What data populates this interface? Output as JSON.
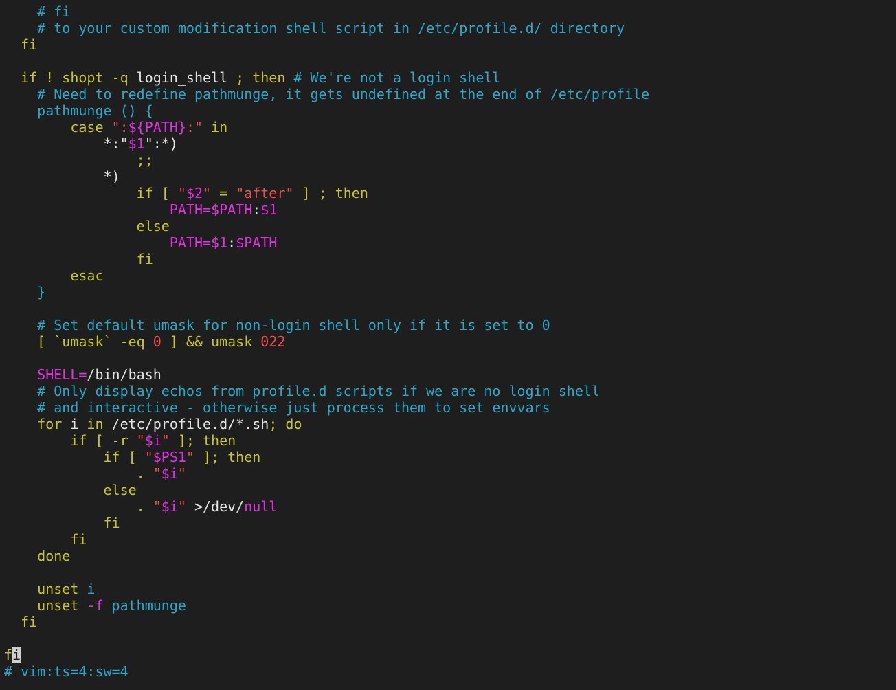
{
  "editor": {
    "name": "vim",
    "theme": {
      "background": "#1e1e1e",
      "comment": "#2aa7c9",
      "keyword": "#c7c62f",
      "plain": "#e4e4e4",
      "special": "#e033e0",
      "number": "#ef4f4f",
      "string": "#ef4f4f",
      "func": "#2aa7c9",
      "cursor": "#cfcfcf"
    },
    "cursor": {
      "line": 39,
      "col": 1
    },
    "lines": [
      [
        [
          "comment",
          "    # fi"
        ]
      ],
      [
        [
          "comment",
          "    # to your custom modification shell script in /etc/profile.d/ directory"
        ]
      ],
      [
        [
          "keyword",
          "  fi"
        ]
      ],
      [],
      [
        [
          "keyword",
          "  if ! shopt -q "
        ],
        [
          "plain",
          "login_shell"
        ],
        [
          "keyword",
          " ; then "
        ],
        [
          "comment",
          "# We're not a login shell"
        ]
      ],
      [
        [
          "comment",
          "    # Need to redefine pathmunge, it gets undefined at the end of /etc/profile"
        ]
      ],
      [
        [
          "func",
          "    pathmunge () {"
        ]
      ],
      [
        [
          "keyword",
          "        case "
        ],
        [
          "string",
          "\":"
        ],
        [
          "special",
          "${PATH}"
        ],
        [
          "string",
          ":\""
        ],
        [
          "keyword",
          " in"
        ]
      ],
      [
        [
          "plain",
          "            *:\""
        ],
        [
          "special",
          "$1"
        ],
        [
          "plain",
          "\":*)"
        ]
      ],
      [
        [
          "keyword",
          "                ;;"
        ]
      ],
      [
        [
          "plain",
          "            *)"
        ]
      ],
      [
        [
          "keyword",
          "                if [ "
        ],
        [
          "string",
          "\""
        ],
        [
          "special",
          "$2"
        ],
        [
          "string",
          "\""
        ],
        [
          "keyword",
          " = "
        ],
        [
          "string",
          "\"after\""
        ],
        [
          "keyword",
          " ] ; then"
        ]
      ],
      [
        [
          "special",
          "                    PATH=$PATH"
        ],
        [
          "plain",
          ":"
        ],
        [
          "special",
          "$1"
        ]
      ],
      [
        [
          "keyword",
          "                else"
        ]
      ],
      [
        [
          "special",
          "                    PATH=$1"
        ],
        [
          "plain",
          ":"
        ],
        [
          "special",
          "$PATH"
        ]
      ],
      [
        [
          "keyword",
          "                fi"
        ]
      ],
      [
        [
          "keyword",
          "        esac"
        ]
      ],
      [
        [
          "func",
          "    }"
        ]
      ],
      [],
      [
        [
          "comment",
          "    # Set default umask for non-login shell only if it is set to 0"
        ]
      ],
      [
        [
          "keyword",
          "    [ `umask` -eq "
        ],
        [
          "number",
          "0"
        ],
        [
          "keyword",
          " ] && umask "
        ],
        [
          "number",
          "022"
        ]
      ],
      [],
      [
        [
          "special",
          "    SHELL="
        ],
        [
          "plain",
          "/bin/bash"
        ]
      ],
      [
        [
          "comment",
          "    # Only display echos from profile.d scripts if we are no login shell"
        ]
      ],
      [
        [
          "comment",
          "    # and interactive - otherwise just process them to set envvars"
        ]
      ],
      [
        [
          "keyword",
          "    for "
        ],
        [
          "plain",
          "i"
        ],
        [
          "keyword",
          " in "
        ],
        [
          "plain",
          "/etc/profile.d/*.sh"
        ],
        [
          "keyword",
          "; do"
        ]
      ],
      [
        [
          "keyword",
          "        if [ -r "
        ],
        [
          "string",
          "\""
        ],
        [
          "special",
          "$i"
        ],
        [
          "string",
          "\""
        ],
        [
          "keyword",
          " ]; then"
        ]
      ],
      [
        [
          "keyword",
          "            if [ "
        ],
        [
          "string",
          "\""
        ],
        [
          "special",
          "$PS1"
        ],
        [
          "string",
          "\""
        ],
        [
          "keyword",
          " ]; then"
        ]
      ],
      [
        [
          "keyword",
          "                . "
        ],
        [
          "string",
          "\""
        ],
        [
          "special",
          "$i"
        ],
        [
          "string",
          "\""
        ]
      ],
      [
        [
          "keyword",
          "            else"
        ]
      ],
      [
        [
          "keyword",
          "                . "
        ],
        [
          "string",
          "\""
        ],
        [
          "special",
          "$i"
        ],
        [
          "string",
          "\""
        ],
        [
          "plain",
          " >/dev/"
        ],
        [
          "special",
          "null"
        ]
      ],
      [
        [
          "keyword",
          "            fi"
        ]
      ],
      [
        [
          "keyword",
          "        fi"
        ]
      ],
      [
        [
          "keyword",
          "    done"
        ]
      ],
      [],
      [
        [
          "keyword",
          "    unset "
        ],
        [
          "func",
          "i"
        ]
      ],
      [
        [
          "keyword",
          "    unset "
        ],
        [
          "special",
          "-f"
        ],
        [
          "func",
          " pathmunge"
        ]
      ],
      [
        [
          "keyword",
          "  fi"
        ]
      ],
      [],
      [
        [
          "keyword",
          "f"
        ],
        [
          "cursor",
          "i"
        ]
      ],
      [
        [
          "comment",
          "# vim:ts=4:sw=4"
        ]
      ]
    ]
  }
}
